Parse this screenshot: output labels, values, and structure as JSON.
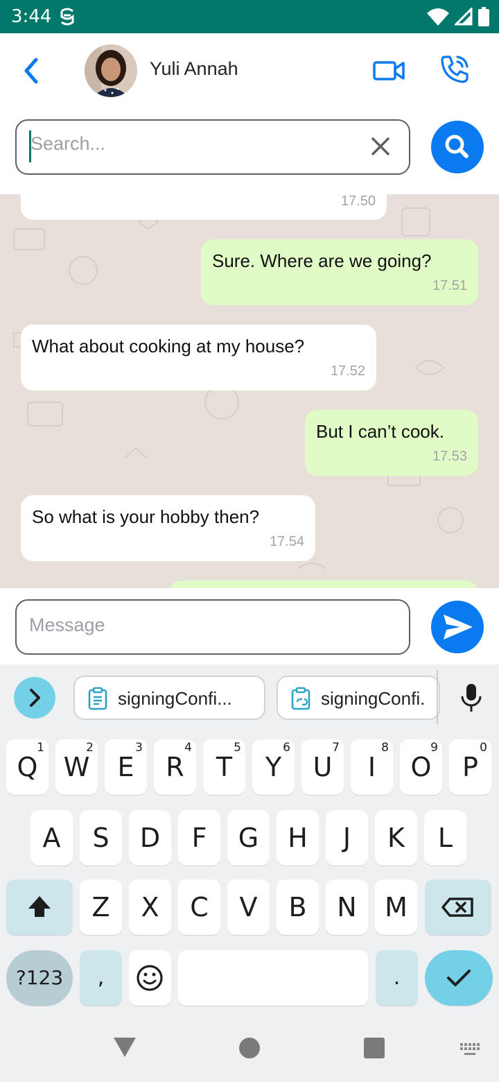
{
  "status_bar": {
    "time": "3:44"
  },
  "header": {
    "contact_name": "Yuli Annah"
  },
  "search": {
    "placeholder": "Search..."
  },
  "messages": [
    {
      "dir": "in",
      "text": "",
      "time": "17.50"
    },
    {
      "dir": "out",
      "text": "Sure. Where are we going?",
      "time": "17.51"
    },
    {
      "dir": "in",
      "text": "What about cooking at my house?",
      "time": "17.52"
    },
    {
      "dir": "out",
      "text": "But I can’t cook.",
      "time": "17.53"
    },
    {
      "dir": "in",
      "text": "So what is your hobby then?",
      "time": "17.54"
    }
  ],
  "composer": {
    "placeholder": "Message"
  },
  "keyboard": {
    "suggestions": [
      "signingConfi...",
      "signingConfi."
    ],
    "row1": [
      [
        "Q",
        "1"
      ],
      [
        "W",
        "2"
      ],
      [
        "E",
        "3"
      ],
      [
        "R",
        "4"
      ],
      [
        "T",
        "5"
      ],
      [
        "Y",
        "6"
      ],
      [
        "U",
        "7"
      ],
      [
        "I",
        "8"
      ],
      [
        "O",
        "9"
      ],
      [
        "P",
        "0"
      ]
    ],
    "row2": [
      "A",
      "S",
      "D",
      "F",
      "G",
      "H",
      "J",
      "K",
      "L"
    ],
    "row3": [
      "Z",
      "X",
      "C",
      "V",
      "B",
      "N",
      "M"
    ],
    "symbols_label": "?123",
    "comma": ",",
    "period": "."
  },
  "colors": {
    "status_bar": "#00796b",
    "accent": "#0a7af0",
    "outgoing_bubble": "#e1fbc6",
    "chat_bg": "#e7e0d8"
  }
}
